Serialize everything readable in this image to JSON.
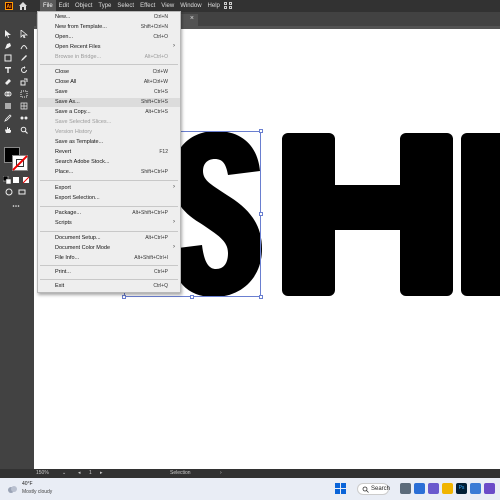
{
  "app": {
    "logo": "Ai",
    "menus": [
      "File",
      "Edit",
      "Object",
      "Type",
      "Select",
      "Effect",
      "View",
      "Window",
      "Help"
    ]
  },
  "document_tab": {
    "close_glyph": "×"
  },
  "file_menu": {
    "items": [
      {
        "label": "New...",
        "shortcut": "Ctrl+N"
      },
      {
        "label": "New from Template...",
        "shortcut": "Shift+Ctrl+N"
      },
      {
        "label": "Open...",
        "shortcut": "Ctrl+O"
      },
      {
        "label": "Open Recent Files",
        "shortcut": "",
        "submenu": true
      },
      {
        "label": "Browse in Bridge...",
        "shortcut": "Alt+Ctrl+O",
        "disabled": true
      },
      {
        "label": "Close",
        "shortcut": "Ctrl+W"
      },
      {
        "label": "Close All",
        "shortcut": "Alt+Ctrl+W"
      },
      {
        "label": "Save",
        "shortcut": "Ctrl+S"
      },
      {
        "label": "Save As...",
        "shortcut": "Shift+Ctrl+S",
        "highlighted": true
      },
      {
        "label": "Save a Copy...",
        "shortcut": "Alt+Ctrl+S"
      },
      {
        "label": "Save Selected Slices...",
        "shortcut": "",
        "disabled": true
      },
      {
        "label": "Version History",
        "shortcut": "",
        "disabled": true
      },
      {
        "label": "Save as Template...",
        "shortcut": ""
      },
      {
        "label": "Revert",
        "shortcut": "F12"
      },
      {
        "label": "Search Adobe Stock...",
        "shortcut": ""
      },
      {
        "label": "Place...",
        "shortcut": "Shift+Ctrl+P"
      },
      {
        "label": "Export",
        "shortcut": "",
        "submenu": true
      },
      {
        "label": "Export Selection...",
        "shortcut": ""
      },
      {
        "label": "Package...",
        "shortcut": "Alt+Shift+Ctrl+P"
      },
      {
        "label": "Scripts",
        "shortcut": "",
        "submenu": true
      },
      {
        "label": "Document Setup...",
        "shortcut": "Alt+Ctrl+P"
      },
      {
        "label": "Document Color Mode",
        "shortcut": "",
        "submenu": true
      },
      {
        "label": "File Info...",
        "shortcut": "Alt+Shift+Ctrl+I"
      },
      {
        "label": "Print...",
        "shortcut": "Ctrl+P"
      },
      {
        "label": "Exit",
        "shortcut": "Ctrl+Q"
      }
    ],
    "submenu_glyph": "›"
  },
  "status_bar": {
    "zoom": "150%",
    "artboard_number": "1",
    "tool_name": "Selection"
  },
  "taskbar": {
    "temperature": "40°F",
    "weather": "Mostly cloudy",
    "search_label": "Search"
  },
  "colors": {
    "accent": "#6a7fd0",
    "fill": "#000000",
    "stroke_none": "#e00000",
    "menu_bg": "#eeeeee"
  }
}
